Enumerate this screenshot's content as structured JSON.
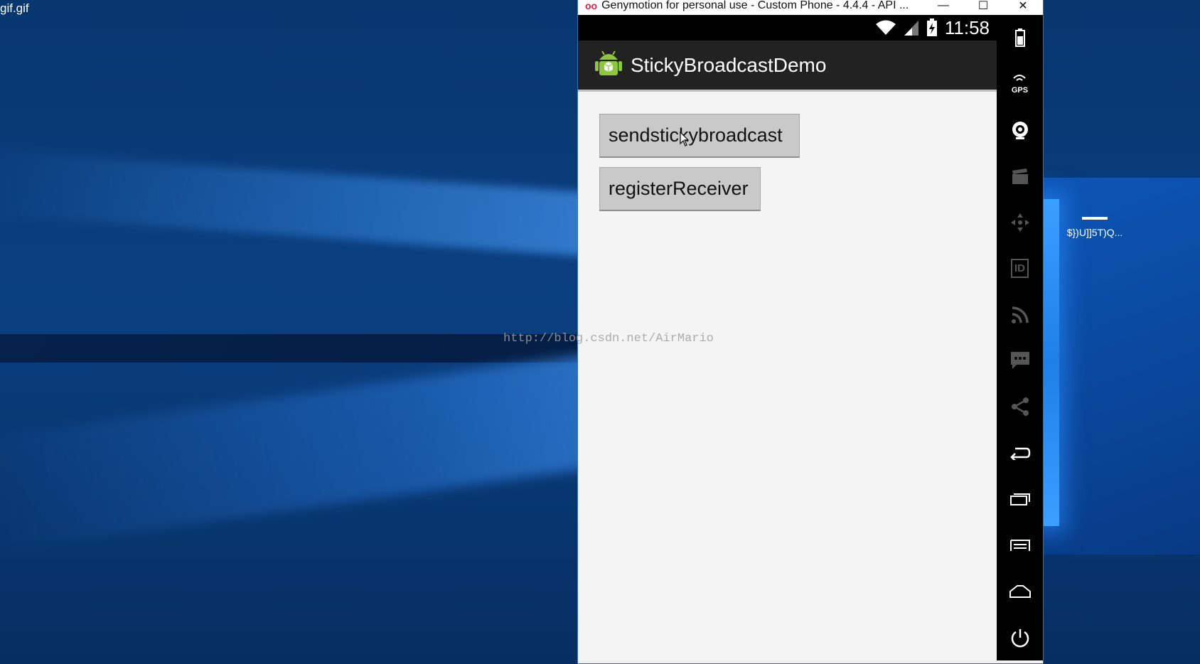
{
  "desktop": {
    "file_label": "gif.gif",
    "icon_label": "$})U]]5T)Q..."
  },
  "window": {
    "title": "Genymotion for personal use - Custom Phone - 4.4.4 - API ...",
    "controls": {
      "minimize": "—",
      "maximize": "☐",
      "close": "✕"
    }
  },
  "android": {
    "status": {
      "time": "11:58"
    },
    "app_title": "StickyBroadcastDemo",
    "buttons": {
      "send": "sendstickybroadcast",
      "register": "registerReceiver"
    }
  },
  "watermark": "http://blog.csdn.net/AirMario",
  "sidebar": {
    "tools": [
      "battery-icon",
      "gps-icon",
      "camera-icon",
      "video-icon",
      "dpad-icon",
      "id-icon",
      "rss-icon",
      "sms-icon",
      "share-icon",
      "back-icon",
      "recents-icon",
      "menu-icon",
      "home-icon",
      "power-icon"
    ],
    "gps_text": "GPS",
    "id_text": "ID"
  }
}
